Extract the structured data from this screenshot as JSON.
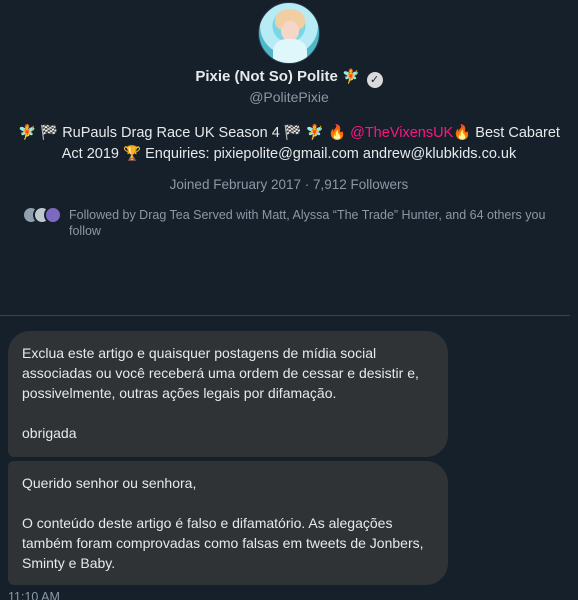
{
  "profile": {
    "display_name": "Pixie (Not So) Polite",
    "name_emoji": "🧚",
    "handle": "@PolitePixie",
    "bio_before_mention": "🧚 🏁 RuPauls Drag Race UK Season 4 🏁 🧚 🔥 ",
    "bio_mention": "@TheVixensUK",
    "bio_after_mention": "🔥 Best Cabaret Act 2019 🏆 Enquiries: pixiepolite@gmail.com andrew@klubkids.co.uk",
    "joined": "Joined February 2017 · 7,912 Followers",
    "followed_by": "Followed by Drag Tea Served with Matt, Alyssa “The Trade” Hunter, and 64 others you follow"
  },
  "messages": [
    {
      "text": "Exclua este artigo e quaisquer postagens de mídia social associadas ou você receberá uma ordem de cessar e desistir e, possivelmente, outras ações legais por difamação.\n\nobrigada"
    },
    {
      "text": "Querido senhor ou senhora,\n\nO conteúdo deste artigo é falso e difamatório. As alegações também foram comprovadas como falsas em tweets de Jonbers, Sminty e Baby."
    }
  ],
  "timestamp": "11:10 AM",
  "colors": {
    "background": "#15202b",
    "bubble": "#2f3336",
    "mention": "#f91880",
    "muted": "#8b98a5"
  },
  "icons": {
    "verified": "verified-badge-icon"
  }
}
